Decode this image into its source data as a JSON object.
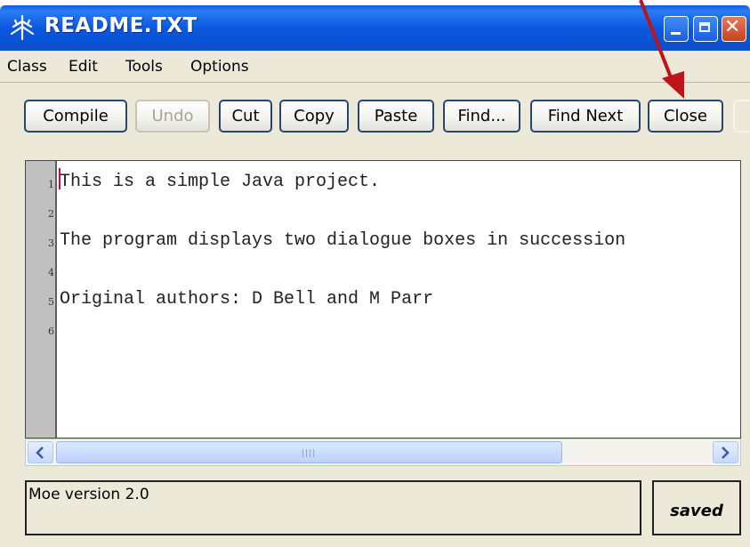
{
  "window": {
    "title": "README.TXT"
  },
  "menu": {
    "items": [
      "Class",
      "Edit",
      "Tools",
      "Options"
    ]
  },
  "toolbar": {
    "buttons": [
      {
        "label": "Compile",
        "enabled": true
      },
      {
        "label": "Undo",
        "enabled": false
      },
      {
        "label": "Cut",
        "enabled": true
      },
      {
        "label": "Copy",
        "enabled": true
      },
      {
        "label": "Paste",
        "enabled": true
      },
      {
        "label": "Find...",
        "enabled": true
      },
      {
        "label": "Find Next",
        "enabled": true
      },
      {
        "label": "Close",
        "enabled": true
      }
    ]
  },
  "editor": {
    "lines": [
      {
        "num": "1",
        "text": "This is a simple Java project."
      },
      {
        "num": "2",
        "text": ""
      },
      {
        "num": "3",
        "text": "The program displays two dialogue boxes in succession"
      },
      {
        "num": "4",
        "text": ""
      },
      {
        "num": "5",
        "text": "Original authors: D Bell and M Parr"
      },
      {
        "num": "6",
        "text": ""
      }
    ]
  },
  "status": {
    "message": "Moe version 2.0",
    "save_state": "saved"
  },
  "colors": {
    "titlebar": "#0b58de",
    "window_bg": "#ECE9D8",
    "annotation_arrow": "#c0121a"
  },
  "icons": {
    "app": "tree-icon",
    "minimize": "minimize-icon",
    "maximize": "maximize-icon",
    "close": "close-icon"
  }
}
